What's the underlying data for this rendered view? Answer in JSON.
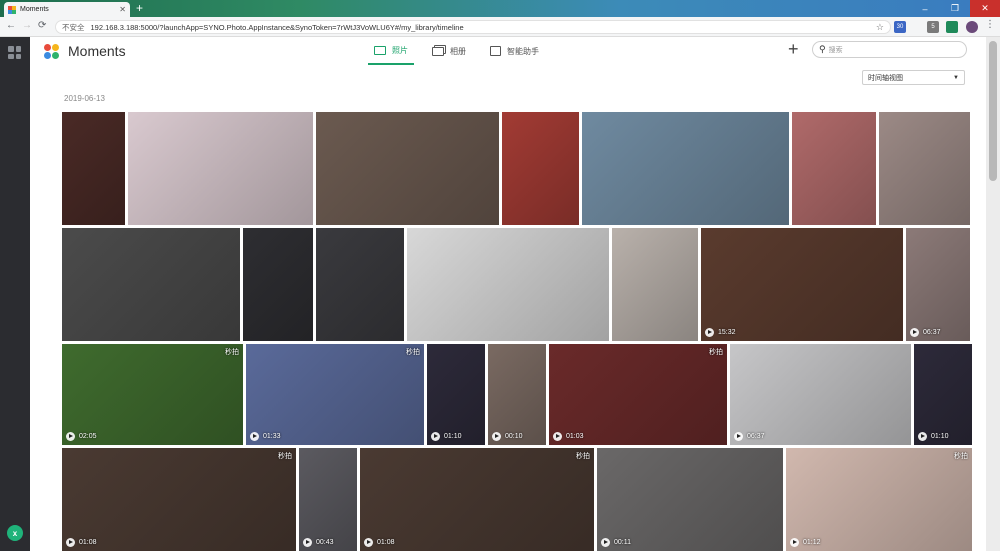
{
  "browser": {
    "tab_title": "Moments",
    "new_tab_glyph": "+",
    "url_security": "不安全",
    "url": "192.168.3.188:5000/?launchApp=SYNO.Photo.AppInstance&SynoToken=7rWtJ3VoWLU6Y#/my_library/timeline",
    "window_controls": [
      "–",
      "❐",
      "✕"
    ],
    "extensions": [
      {
        "label": "30",
        "color": "#3b66c4"
      },
      {
        "label": "5",
        "color": "#7a7a7a"
      },
      {
        "label": "",
        "color": "#1f8a5a"
      }
    ]
  },
  "sidebar": {
    "bottom_badge": "x",
    "grid_icon": "apps-grid-icon"
  },
  "app": {
    "title": "Moments",
    "logo_colors": [
      "#e84b3c",
      "#f5b51c",
      "#3b8be0",
      "#2fb36c"
    ],
    "tabs": [
      {
        "label": "照片",
        "icon": "photo-icon",
        "active": true
      },
      {
        "label": "相册",
        "icon": "album-icon",
        "active": false
      },
      {
        "label": "智能助手",
        "icon": "assistant-icon",
        "active": false
      }
    ],
    "add_label": "+",
    "search_placeholder": "搜索",
    "view_select": "时间轴视图",
    "accent_color": "#1aa26a"
  },
  "timeline": {
    "date": "2019-06-13",
    "photos": [
      {
        "color": "#4a2a26",
        "video": false
      },
      {
        "color": "#d9c9cf",
        "video": false
      },
      {
        "color": "#6b5a50",
        "video": false
      },
      {
        "color": "#a23b34",
        "video": false
      },
      {
        "color": "#6f8aa0",
        "video": false
      },
      {
        "color": "#b06a6a",
        "video": false
      },
      {
        "color": "#9c8a86",
        "video": false
      },
      {
        "color": "#4b4b4b",
        "video": false
      },
      {
        "color": "#2e2e32",
        "video": false
      },
      {
        "color": "#3a3a3e",
        "video": false
      },
      {
        "color": "#d8d8d8",
        "video": false
      },
      {
        "color": "#b9b1ab",
        "video": false
      },
      {
        "color": "#5a3b2e",
        "video": true,
        "duration": "15:32"
      },
      {
        "color": "#8c7a78",
        "video": true,
        "duration": "06:37"
      },
      {
        "color": "#3f6b2e",
        "video": true,
        "duration": "02:05",
        "watermark": "秒拍"
      },
      {
        "color": "#5a6a9a",
        "video": true,
        "duration": "01:33",
        "watermark": "秒拍"
      },
      {
        "color": "#2d2a3a",
        "video": true,
        "duration": "01:10"
      },
      {
        "color": "#7a6a62",
        "video": true,
        "duration": "00:10"
      },
      {
        "color": "#6a2a2a",
        "video": true,
        "duration": "01:03",
        "watermark": "秒拍"
      },
      {
        "color": "#c6c6c8",
        "video": true,
        "duration": "06:37"
      },
      {
        "color": "#2d2a3a",
        "video": true,
        "duration": "01:10"
      },
      {
        "color": "#4a3a32",
        "video": true,
        "duration": "01:08",
        "watermark": "秒拍"
      },
      {
        "color": "#5b5a60",
        "video": true,
        "duration": "00:43"
      },
      {
        "color": "#4a3a32",
        "video": true,
        "duration": "01:08",
        "watermark": "秒拍"
      },
      {
        "color": "#6a6868",
        "video": true,
        "duration": "00:11"
      },
      {
        "color": "#d1b8ae",
        "video": true,
        "duration": "01:12",
        "watermark": "秒拍"
      }
    ]
  }
}
